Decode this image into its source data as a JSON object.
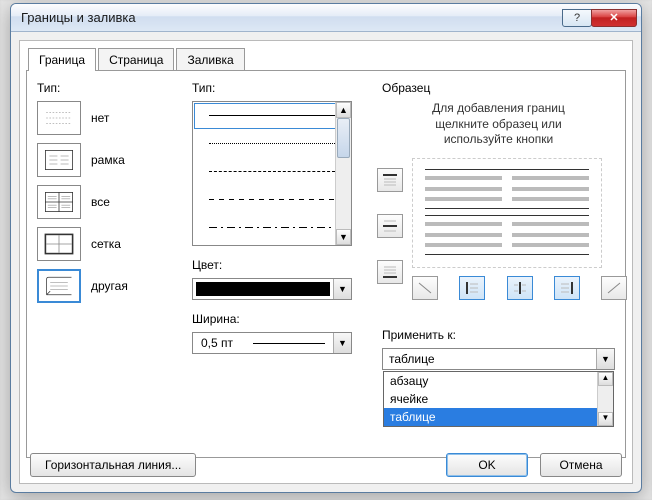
{
  "window": {
    "title": "Границы и заливка"
  },
  "tabs": {
    "border": "Граница",
    "page": "Страница",
    "shading": "Заливка"
  },
  "left": {
    "label": "Тип:",
    "presets": {
      "none": "нет",
      "box": "рамка",
      "all": "все",
      "grid": "сетка",
      "custom": "другая"
    }
  },
  "style": {
    "label": "Тип:"
  },
  "color": {
    "label": "Цвет:",
    "value": "#000000"
  },
  "width": {
    "label": "Ширина:",
    "value": "0,5 пт"
  },
  "preview": {
    "label": "Образец",
    "hint1": "Для добавления границ",
    "hint2": "щелкните образец или",
    "hint3": "используйте кнопки"
  },
  "apply": {
    "label": "Применить к:",
    "value": "таблице",
    "options": [
      "абзацу",
      "ячейке",
      "таблице"
    ]
  },
  "footer": {
    "hline": "Горизонтальная линия...",
    "ok": "OK",
    "cancel": "Отмена"
  }
}
